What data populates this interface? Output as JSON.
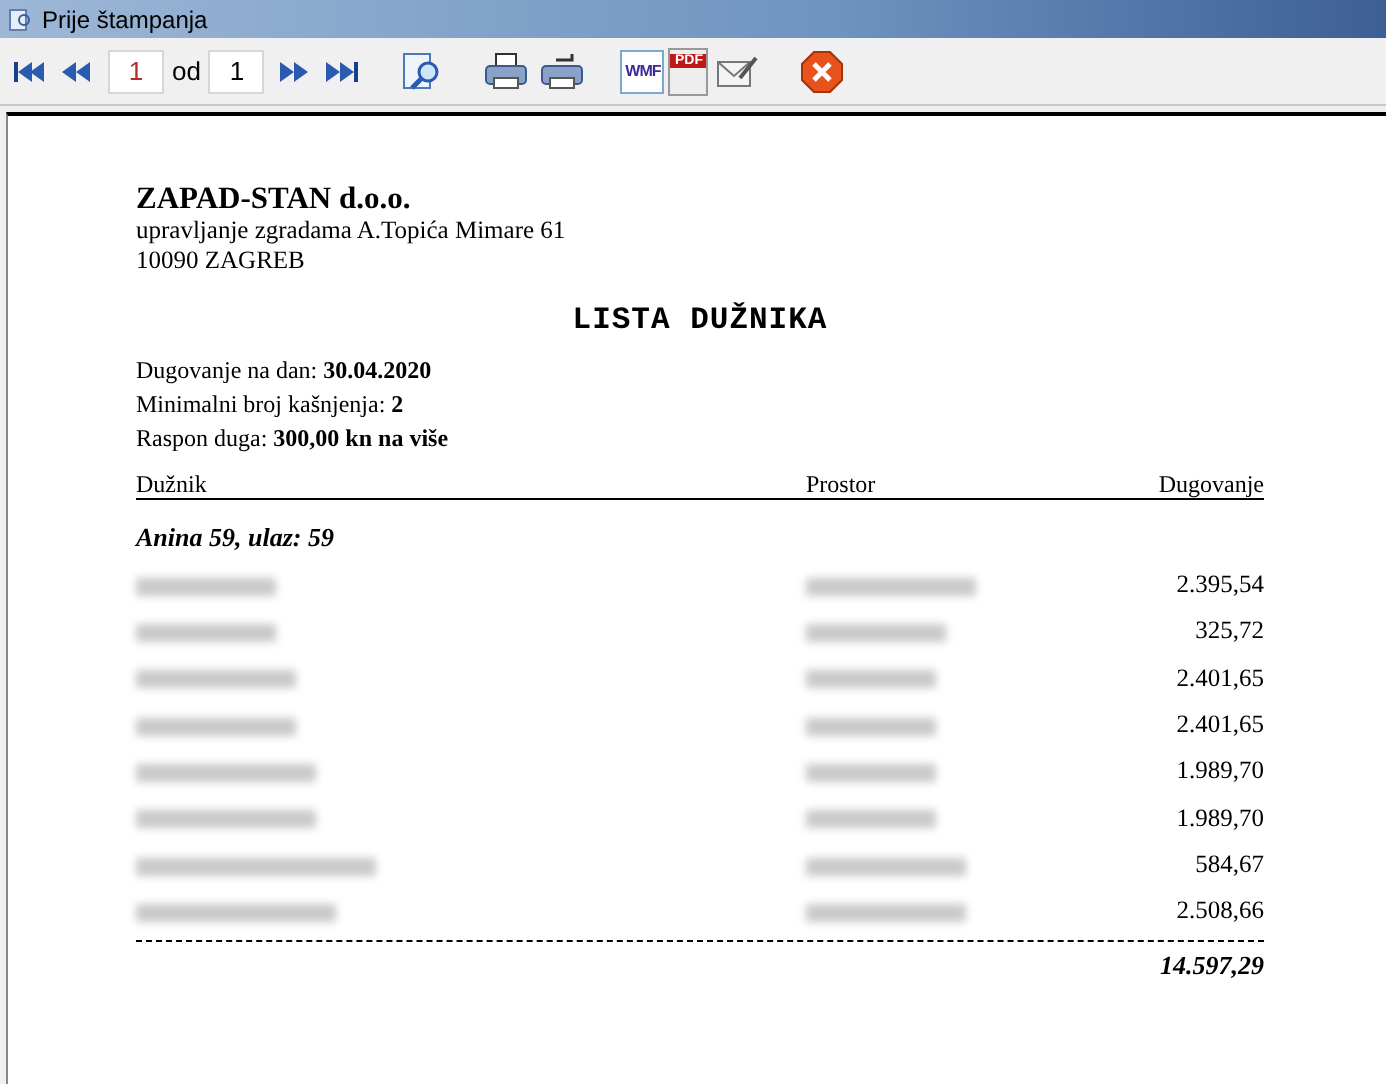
{
  "window": {
    "title": "Prije štampanja"
  },
  "toolbar": {
    "page_value": "1",
    "of_label": "od",
    "total_value": "1",
    "wmf_label": "WMF",
    "pdf_label": "PDF"
  },
  "report": {
    "company": "ZAPAD-STAN d.o.o.",
    "address": "upravljanje zgradama A.Topića Mimare 61",
    "city": "10090 ZAGREB",
    "title": "LISTA DUŽNIKA",
    "info": [
      "Dugovanje na dan:  **30.04.2020**",
      "Minimalni broj kašnjenja: **2**",
      "Raspon duga:  **300,00 kn  na više**"
    ],
    "columns": [
      "Dužnik",
      "Prostor",
      "Dugovanje"
    ],
    "group": "Anina 59, ulaz: 59",
    "rows": [
      {
        "amount": "2.395,54"
      },
      {
        "amount": "325,72"
      },
      {
        "amount": "2.401,65"
      },
      {
        "amount": "2.401,65"
      },
      {
        "amount": "1.989,70"
      },
      {
        "amount": "1.989,70"
      },
      {
        "amount": "584,67"
      },
      {
        "amount": "2.508,66"
      }
    ],
    "total": "14.597,29"
  }
}
